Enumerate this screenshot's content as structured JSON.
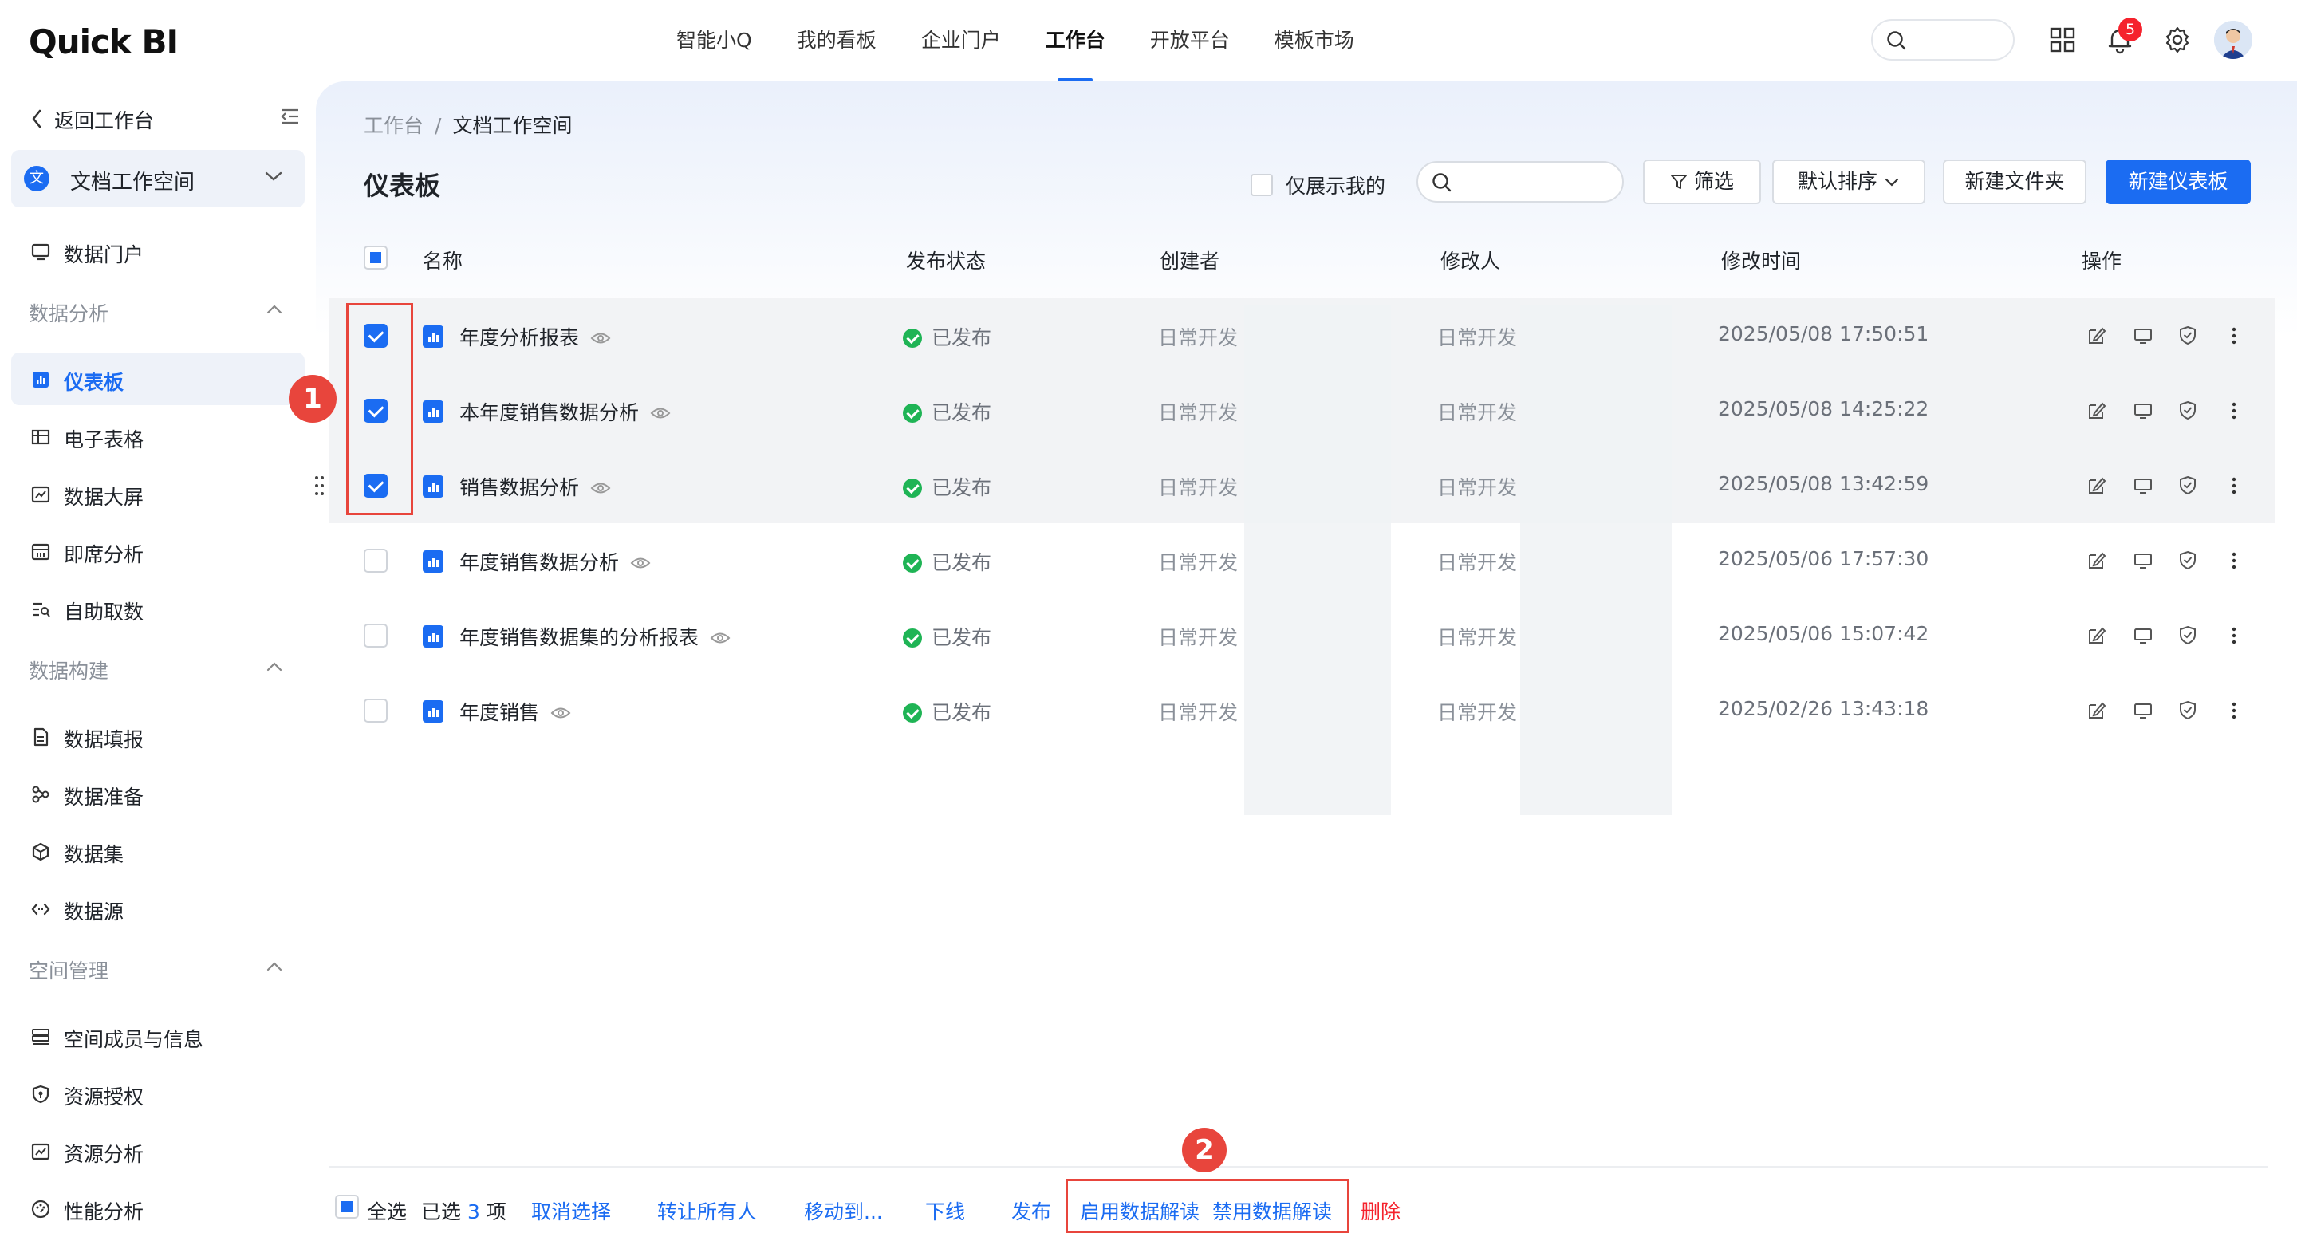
{
  "app": {
    "logo": "Quick BI"
  },
  "topnav": {
    "items": [
      "智能小Q",
      "我的看板",
      "企业门户",
      "工作台",
      "开放平台",
      "模板市场"
    ],
    "active_index": 3,
    "notification_count": "5"
  },
  "sidebar": {
    "back_label": "返回工作台",
    "workspace_icon": "文",
    "workspace_name": "文档工作空间",
    "portal": "数据门户",
    "groups": {
      "analysis": "数据分析",
      "build": "数据构建",
      "space": "空间管理"
    },
    "analysis_items": [
      "仪表板",
      "电子表格",
      "数据大屏",
      "即席分析",
      "自助取数"
    ],
    "build_items": [
      "数据填报",
      "数据准备",
      "数据集",
      "数据源"
    ],
    "space_items": [
      "空间成员与信息",
      "资源授权",
      "资源分析",
      "性能分析"
    ],
    "active_item": "仪表板"
  },
  "main": {
    "breadcrumb": {
      "parent": "工作台",
      "separator": "/",
      "current": "文档工作空间"
    },
    "title": "仪表板",
    "only_mine_label": "仅展示我的",
    "filter_label": "筛选",
    "sort_label": "默认排序",
    "new_folder_label": "新建文件夹",
    "new_dashboard_label": "新建仪表板",
    "columns": [
      "名称",
      "发布状态",
      "创建者",
      "修改人",
      "修改时间",
      "操作"
    ],
    "rows": [
      {
        "name": "年度分析报表",
        "status": "已发布",
        "creator": "日常开发",
        "modifier": "日常开发",
        "mtime": "2025/05/08 17:50:51",
        "checked": true
      },
      {
        "name": "本年度销售数据分析",
        "status": "已发布",
        "creator": "日常开发",
        "modifier": "日常开发",
        "mtime": "2025/05/08 14:25:22",
        "checked": true
      },
      {
        "name": "销售数据分析",
        "status": "已发布",
        "creator": "日常开发",
        "modifier": "日常开发",
        "mtime": "2025/05/08 13:42:59",
        "checked": true
      },
      {
        "name": "年度销售数据分析",
        "status": "已发布",
        "creator": "日常开发",
        "modifier": "日常开发",
        "mtime": "2025/05/06 17:57:30",
        "checked": false
      },
      {
        "name": "年度销售数据集的分析报表",
        "status": "已发布",
        "creator": "日常开发",
        "modifier": "日常开发",
        "mtime": "2025/05/06 15:07:42",
        "checked": false
      },
      {
        "name": "年度销售",
        "status": "已发布",
        "creator": "日常开发",
        "modifier": "日常开发",
        "mtime": "2025/02/26 13:43:18",
        "checked": false
      }
    ]
  },
  "bottombar": {
    "select_all": "全选",
    "selected_prefix": "已选",
    "selected_count": "3",
    "selected_suffix": "项",
    "cancel": "取消选择",
    "transfer": "转让所有人",
    "move": "移动到...",
    "offline": "下线",
    "publish": "发布",
    "enable_interpret": "启用数据解读",
    "disable_interpret": "禁用数据解读",
    "delete": "删除"
  },
  "annotations": {
    "callout_1": "1",
    "callout_2": "2"
  },
  "colors": {
    "accent": "#1b6cf2",
    "success": "#1fb455",
    "danger": "#f5222d",
    "annotation": "#e8453c"
  }
}
